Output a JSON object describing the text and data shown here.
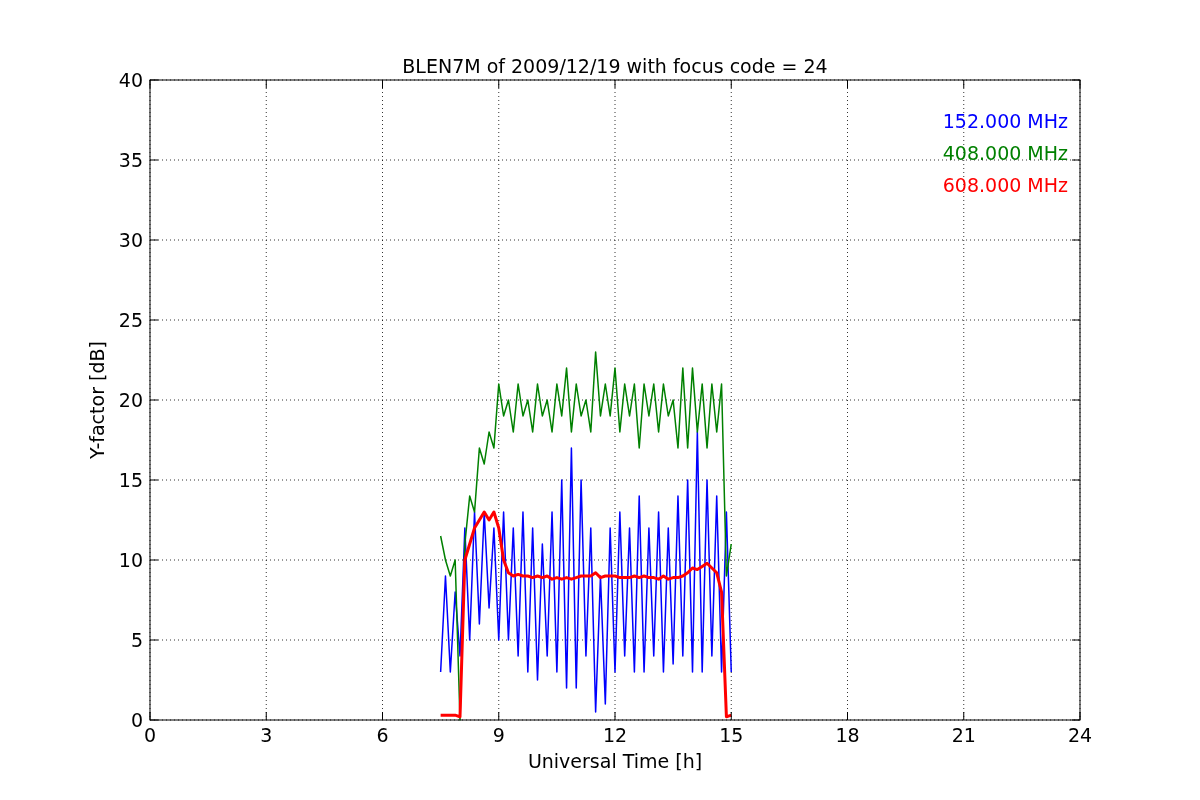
{
  "chart_data": {
    "type": "line",
    "title": "BLEN7M of 2009/12/19 with focus code = 24",
    "xlabel": "Universal Time [h]",
    "ylabel": "Y-factor [dB]",
    "x": [
      7.5,
      7.625,
      7.75,
      7.875,
      8.0,
      8.125,
      8.25,
      8.375,
      8.5,
      8.625,
      8.75,
      8.875,
      9.0,
      9.125,
      9.25,
      9.375,
      9.5,
      9.625,
      9.75,
      9.875,
      10.0,
      10.125,
      10.25,
      10.375,
      10.5,
      10.625,
      10.75,
      10.875,
      11.0,
      11.125,
      11.25,
      11.375,
      11.5,
      11.625,
      11.75,
      11.875,
      12.0,
      12.125,
      12.25,
      12.375,
      12.5,
      12.625,
      12.75,
      12.875,
      13.0,
      13.125,
      13.25,
      13.375,
      13.5,
      13.625,
      13.75,
      13.875,
      14.0,
      14.125,
      14.25,
      14.375,
      14.5,
      14.625,
      14.75,
      14.875,
      15.0
    ],
    "series": [
      {
        "name": "152.000 MHz",
        "color": "#0000ff",
        "values": [
          3,
          9,
          3,
          8,
          4,
          12,
          5,
          13,
          6,
          13,
          7,
          12,
          5,
          13,
          5,
          12,
          4,
          13,
          3,
          12,
          2.5,
          11,
          4,
          13,
          3,
          15,
          2,
          17,
          2,
          15,
          4,
          12,
          0.5,
          9,
          1,
          12,
          3,
          13,
          4,
          12,
          3,
          14,
          3,
          12,
          4,
          13,
          3,
          12,
          3.5,
          14,
          4,
          15,
          3,
          18,
          3,
          15,
          4,
          14,
          3,
          13,
          3
        ]
      },
      {
        "name": "408.000 MHz",
        "color": "#008000",
        "values": [
          11.5,
          10,
          9,
          10,
          0,
          11,
          14,
          13,
          17,
          16,
          18,
          17,
          21,
          19,
          20,
          18,
          21,
          19,
          20,
          18,
          21,
          19,
          20,
          18,
          21,
          19,
          22,
          18,
          21,
          19,
          20,
          18,
          23,
          19,
          21,
          19,
          22,
          18,
          21,
          19,
          21,
          17,
          21,
          19,
          21,
          18,
          21,
          19,
          20,
          17,
          22,
          17,
          22,
          18,
          21,
          17,
          21,
          18,
          21,
          9,
          11
        ]
      },
      {
        "name": "608.000 MHz",
        "color": "#ff0000",
        "values": [
          0.3,
          0.3,
          0.3,
          0.3,
          0.2,
          10,
          11,
          12,
          12.5,
          13,
          12.5,
          13,
          12,
          10,
          9.2,
          9,
          9.1,
          9,
          9,
          8.9,
          9,
          8.9,
          9,
          8.8,
          8.9,
          8.8,
          8.9,
          8.8,
          8.9,
          9,
          9,
          9,
          9.2,
          8.9,
          9,
          9,
          9,
          8.9,
          8.9,
          8.9,
          9,
          8.9,
          9,
          8.9,
          8.9,
          8.8,
          9,
          8.8,
          8.9,
          8.9,
          9,
          9.2,
          9.5,
          9.4,
          9.6,
          9.8,
          9.5,
          9.2,
          8,
          0.2,
          0.3
        ]
      }
    ],
    "xlim": [
      0,
      24
    ],
    "ylim": [
      0,
      40
    ],
    "xticks": [
      0,
      3,
      6,
      9,
      12,
      15,
      18,
      21,
      24
    ],
    "yticks": [
      0,
      5,
      10,
      15,
      20,
      25,
      30,
      35,
      40
    ],
    "grid": true
  }
}
